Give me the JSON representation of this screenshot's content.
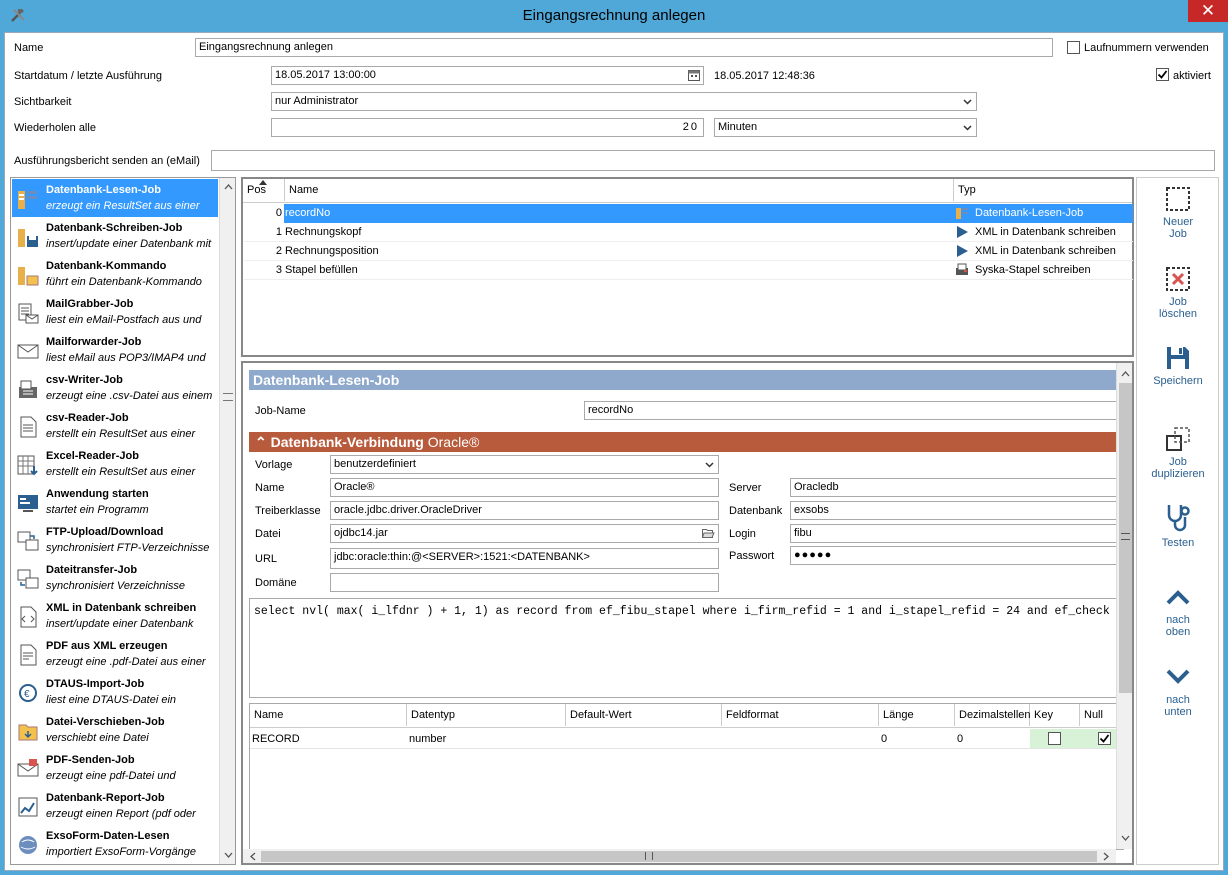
{
  "window": {
    "title": "Eingangsrechnung anlegen",
    "close_label": "✕"
  },
  "form": {
    "name_label": "Name",
    "name_value": "Eingangsrechnung anlegen",
    "laufnummern_label": "Laufnummern verwenden",
    "start_label": "Startdatum / letzte Ausführung",
    "start_value": "18.05.2017 13:00:00",
    "last_run": "18.05.2017 12:48:36",
    "aktiviert_label": "aktiviert",
    "sichtbarkeit_label": "Sichtbarkeit",
    "sichtbarkeit_value": "nur Administrator",
    "wiederholen_label": "Wiederholen alle",
    "wiederholen_value": "20",
    "wiederholen_unit": "Minuten",
    "email_label": "Ausführungsbericht senden an (eMail)",
    "email_value": ""
  },
  "sidebar": {
    "items": [
      {
        "title": "Datenbank-Lesen-Job",
        "desc": "erzeugt ein ResultSet aus einer"
      },
      {
        "title": "Datenbank-Schreiben-Job",
        "desc": "insert/update einer Datenbank mit"
      },
      {
        "title": "Datenbank-Kommando",
        "desc": "führt ein Datenbank-Kommando"
      },
      {
        "title": "MailGrabber-Job",
        "desc": "liest ein eMail-Postfach aus und"
      },
      {
        "title": "Mailforwarder-Job",
        "desc": "liest eMail aus POP3/IMAP4 und"
      },
      {
        "title": "csv-Writer-Job",
        "desc": "erzeugt eine .csv-Datei aus einem"
      },
      {
        "title": "csv-Reader-Job",
        "desc": "erstellt ein ResultSet aus einer"
      },
      {
        "title": "Excel-Reader-Job",
        "desc": "erstellt ein ResultSet aus einer"
      },
      {
        "title": "Anwendung starten",
        "desc": "startet ein Programm"
      },
      {
        "title": "FTP-Upload/Download",
        "desc": "synchronisiert FTP-Verzeichnisse"
      },
      {
        "title": "Dateitransfer-Job",
        "desc": "synchronisiert Verzeichnisse"
      },
      {
        "title": "XML in Datenbank schreiben",
        "desc": "insert/update einer Datenbank"
      },
      {
        "title": "PDF aus XML erzeugen",
        "desc": "erzeugt eine .pdf-Datei aus einer"
      },
      {
        "title": "DTAUS-Import-Job",
        "desc": "liest eine DTAUS-Datei ein"
      },
      {
        "title": "Datei-Verschieben-Job",
        "desc": "verschiebt eine Datei"
      },
      {
        "title": "PDF-Senden-Job",
        "desc": "erzeugt eine pdf-Datei und"
      },
      {
        "title": "Datenbank-Report-Job",
        "desc": "erzeugt einen Report (pdf oder"
      },
      {
        "title": "ExsoForm-Daten-Lesen",
        "desc": "importiert ExsoForm-Vorgänge"
      }
    ]
  },
  "jobs": {
    "headers": [
      "Pos",
      "Name",
      "Typ"
    ],
    "rows": [
      {
        "pos": "0",
        "name": "recordNo",
        "typ": "Datenbank-Lesen-Job"
      },
      {
        "pos": "1",
        "name": "Rechnungskopf",
        "typ": "XML in Datenbank schreiben"
      },
      {
        "pos": "2",
        "name": "Rechnungsposition",
        "typ": "XML in Datenbank schreiben"
      },
      {
        "pos": "3",
        "name": "Stapel befüllen",
        "typ": "Syska-Stapel schreiben"
      }
    ]
  },
  "detail": {
    "header": "Datenbank-Lesen-Job",
    "jobname_label": "Job-Name",
    "jobname_value": "recordNo",
    "conn_header": "Datenbank-Verbindung",
    "conn_type": "Oracle®",
    "vorlage_label": "Vorlage",
    "vorlage_value": "benutzerdefiniert",
    "name_label": "Name",
    "name_value": "Oracle®",
    "treiber_label": "Treiberklasse",
    "treiber_value": "oracle.jdbc.driver.OracleDriver",
    "datei_label": "Datei",
    "datei_value": "ojdbc14.jar",
    "url_label": "URL",
    "url_value": "jdbc:oracle:thin:@<SERVER>:1521:<DATENBANK>",
    "domaene_label": "Domäne",
    "domaene_value": "",
    "server_label": "Server",
    "server_value": "Oracledb",
    "datenbank_label": "Datenbank",
    "datenbank_value": "exsobs",
    "login_label": "Login",
    "login_value": "fibu",
    "passwort_label": "Passwort",
    "passwort_value": "●●●●●",
    "sql": "select nvl( max( i_lfdnr ) + 1, 1) as record from ef_fibu_stapel where i_firm_refid = 1 and i_stapel_refid = 24 and ef_check"
  },
  "fields": {
    "headers": [
      "Name",
      "Datentyp",
      "Default-Wert",
      "Feldformat",
      "Länge",
      "Dezimalstellen",
      "Key",
      "Null"
    ],
    "rows": [
      {
        "name": "RECORD",
        "datentyp": "number",
        "default": "",
        "format": "",
        "laenge": "0",
        "dez": "0"
      }
    ]
  },
  "actions": {
    "neuer_job": "Neuer\nJob",
    "neu1": "Neuer",
    "neu2": "Job",
    "del1": "Job",
    "del2": "löschen",
    "save": "Speichern",
    "dup1": "Job",
    "dup2": "duplizieren",
    "test": "Testen",
    "up1": "nach",
    "up2": "oben",
    "down1": "nach",
    "down2": "unten"
  },
  "colors": {
    "accent": "#3399ff",
    "section_header": "#b85a3c",
    "detail_header": "#8fa9cc",
    "title_bar": "#4fa8d8"
  }
}
